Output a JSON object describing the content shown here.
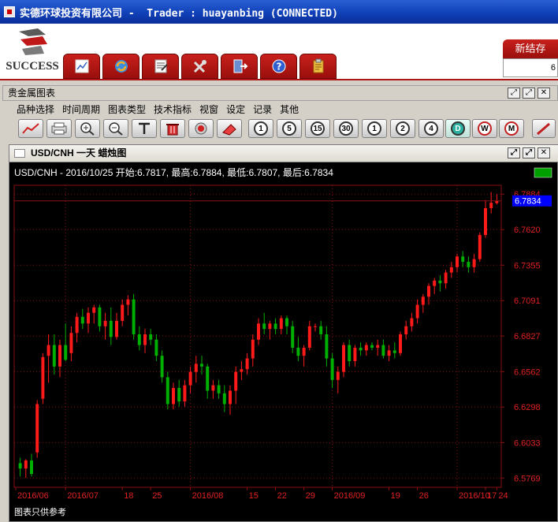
{
  "titlebar": {
    "title": "实德环球投资有限公司 -  Trader : huayanbing (CONNECTED)"
  },
  "logo": {
    "text": "SUCCESS"
  },
  "main_toolbar": [
    {
      "name": "chart-tool-button",
      "icon": "chart-paper-icon"
    },
    {
      "name": "refresh-tool-button",
      "icon": "refresh-icon"
    },
    {
      "name": "report-tool-button",
      "icon": "report-icon"
    },
    {
      "name": "settings-tool-button",
      "icon": "tools-icon"
    },
    {
      "name": "exit-tool-button",
      "icon": "exit-door-icon"
    },
    {
      "name": "help-tool-button",
      "icon": "help-icon"
    },
    {
      "name": "clipboard-tool-button",
      "icon": "clipboard-icon"
    }
  ],
  "newsave": {
    "label": "新结存",
    "value": "6"
  },
  "panel": {
    "title": "贵金属图表"
  },
  "menu": [
    "品种选择",
    "时间周期",
    "图表类型",
    "技术指标",
    "视窗",
    "设定",
    "记录",
    "其他"
  ],
  "chart_toolbar": {
    "periods": [
      "1",
      "5",
      "15",
      "30",
      "1",
      "2",
      "4",
      "D",
      "W",
      "M"
    ],
    "tools": [
      "line-chart-icon",
      "print-icon",
      "zoom-in-icon",
      "zoom-out-icon",
      "text-tool-icon",
      "delete-icon",
      "record-icon",
      "clear-icon"
    ]
  },
  "chart_window": {
    "caption": "USD/CNH 一天 蜡烛图",
    "info": "USD/CNH - 2016/10/25 开始:6.7817, 最高:6.7884, 最低:6.7807, 最后:6.7834",
    "disclaimer": "图表只供参考",
    "last_price_label": "6.7834",
    "colors": {
      "up": "#ff1a1a",
      "down": "#00b000",
      "grid": "#8a1010",
      "axis_text": "#e02020",
      "price_tag": "#0000ff"
    }
  },
  "chart_data": {
    "type": "candlestick",
    "title": "USD/CNH 一天 蜡烛图",
    "y_ticks": [
      6.5769,
      6.6033,
      6.6298,
      6.6562,
      6.6827,
      6.7091,
      6.7355,
      6.762,
      6.7884
    ],
    "ylim": [
      6.57,
      6.795
    ],
    "x_labels": [
      "2016/06",
      "2016/07",
      "18",
      "25",
      "2016/08",
      "15",
      "22",
      "29",
      "2016/09",
      "19",
      "26",
      "2016/10",
      "17",
      "24"
    ],
    "last_price": 6.7834,
    "candles": [
      {
        "o": 6.588,
        "h": 6.592,
        "l": 6.578,
        "c": 6.584
      },
      {
        "o": 6.584,
        "h": 6.591,
        "l": 6.577,
        "c": 6.59
      },
      {
        "o": 6.59,
        "h": 6.595,
        "l": 6.578,
        "c": 6.58
      },
      {
        "o": 6.596,
        "h": 6.635,
        "l": 6.592,
        "c": 6.632
      },
      {
        "o": 6.636,
        "h": 6.67,
        "l": 6.632,
        "c": 6.667
      },
      {
        "o": 6.668,
        "h": 6.684,
        "l": 6.648,
        "c": 6.676
      },
      {
        "o": 6.676,
        "h": 6.684,
        "l": 6.654,
        "c": 6.66
      },
      {
        "o": 6.66,
        "h": 6.68,
        "l": 6.652,
        "c": 6.676
      },
      {
        "o": 6.676,
        "h": 6.692,
        "l": 6.664,
        "c": 6.665
      },
      {
        "o": 6.67,
        "h": 6.69,
        "l": 6.664,
        "c": 6.685
      },
      {
        "o": 6.685,
        "h": 6.7,
        "l": 6.678,
        "c": 6.697
      },
      {
        "o": 6.697,
        "h": 6.703,
        "l": 6.688,
        "c": 6.692
      },
      {
        "o": 6.692,
        "h": 6.704,
        "l": 6.685,
        "c": 6.7
      },
      {
        "o": 6.7,
        "h": 6.706,
        "l": 6.692,
        "c": 6.704
      },
      {
        "o": 6.704,
        "h": 6.706,
        "l": 6.686,
        "c": 6.69
      },
      {
        "o": 6.69,
        "h": 6.7,
        "l": 6.68,
        "c": 6.694
      },
      {
        "o": 6.694,
        "h": 6.704,
        "l": 6.676,
        "c": 6.682
      },
      {
        "o": 6.682,
        "h": 6.7,
        "l": 6.68,
        "c": 6.694
      },
      {
        "o": 6.694,
        "h": 6.71,
        "l": 6.69,
        "c": 6.706
      },
      {
        "o": 6.706,
        "h": 6.713,
        "l": 6.698,
        "c": 6.71
      },
      {
        "o": 6.71,
        "h": 6.714,
        "l": 6.68,
        "c": 6.684
      },
      {
        "o": 6.684,
        "h": 6.69,
        "l": 6.672,
        "c": 6.676
      },
      {
        "o": 6.676,
        "h": 6.688,
        "l": 6.67,
        "c": 6.684
      },
      {
        "o": 6.684,
        "h": 6.688,
        "l": 6.676,
        "c": 6.68
      },
      {
        "o": 6.68,
        "h": 6.684,
        "l": 6.664,
        "c": 6.668
      },
      {
        "o": 6.668,
        "h": 6.672,
        "l": 6.648,
        "c": 6.652
      },
      {
        "o": 6.652,
        "h": 6.656,
        "l": 6.628,
        "c": 6.632
      },
      {
        "o": 6.632,
        "h": 6.648,
        "l": 6.628,
        "c": 6.644
      },
      {
        "o": 6.644,
        "h": 6.65,
        "l": 6.63,
        "c": 6.634
      },
      {
        "o": 6.634,
        "h": 6.65,
        "l": 6.63,
        "c": 6.646
      },
      {
        "o": 6.646,
        "h": 6.66,
        "l": 6.64,
        "c": 6.656
      },
      {
        "o": 6.656,
        "h": 6.668,
        "l": 6.648,
        "c": 6.662
      },
      {
        "o": 6.662,
        "h": 6.668,
        "l": 6.654,
        "c": 6.66
      },
      {
        "o": 6.66,
        "h": 6.662,
        "l": 6.636,
        "c": 6.642
      },
      {
        "o": 6.642,
        "h": 6.65,
        "l": 6.636,
        "c": 6.646
      },
      {
        "o": 6.646,
        "h": 6.65,
        "l": 6.636,
        "c": 6.64
      },
      {
        "o": 6.64,
        "h": 6.646,
        "l": 6.626,
        "c": 6.632
      },
      {
        "o": 6.632,
        "h": 6.646,
        "l": 6.624,
        "c": 6.642
      },
      {
        "o": 6.642,
        "h": 6.66,
        "l": 6.632,
        "c": 6.656
      },
      {
        "o": 6.656,
        "h": 6.664,
        "l": 6.65,
        "c": 6.658
      },
      {
        "o": 6.658,
        "h": 6.67,
        "l": 6.654,
        "c": 6.666
      },
      {
        "o": 6.666,
        "h": 6.684,
        "l": 6.66,
        "c": 6.68
      },
      {
        "o": 6.68,
        "h": 6.696,
        "l": 6.676,
        "c": 6.692
      },
      {
        "o": 6.692,
        "h": 6.7,
        "l": 6.684,
        "c": 6.688
      },
      {
        "o": 6.688,
        "h": 6.694,
        "l": 6.68,
        "c": 6.692
      },
      {
        "o": 6.692,
        "h": 6.696,
        "l": 6.684,
        "c": 6.688
      },
      {
        "o": 6.688,
        "h": 6.698,
        "l": 6.684,
        "c": 6.696
      },
      {
        "o": 6.696,
        "h": 6.698,
        "l": 6.684,
        "c": 6.69
      },
      {
        "o": 6.69,
        "h": 6.694,
        "l": 6.67,
        "c": 6.674
      },
      {
        "o": 6.674,
        "h": 6.682,
        "l": 6.664,
        "c": 6.668
      },
      {
        "o": 6.668,
        "h": 6.676,
        "l": 6.66,
        "c": 6.674
      },
      {
        "o": 6.674,
        "h": 6.694,
        "l": 6.672,
        "c": 6.69
      },
      {
        "o": 6.69,
        "h": 6.692,
        "l": 6.686,
        "c": 6.69
      },
      {
        "o": 6.69,
        "h": 6.694,
        "l": 6.68,
        "c": 6.684
      },
      {
        "o": 6.684,
        "h": 6.69,
        "l": 6.66,
        "c": 6.666
      },
      {
        "o": 6.666,
        "h": 6.67,
        "l": 6.644,
        "c": 6.65
      },
      {
        "o": 6.65,
        "h": 6.66,
        "l": 6.64,
        "c": 6.656
      },
      {
        "o": 6.656,
        "h": 6.678,
        "l": 6.652,
        "c": 6.676
      },
      {
        "o": 6.676,
        "h": 6.68,
        "l": 6.66,
        "c": 6.664
      },
      {
        "o": 6.664,
        "h": 6.676,
        "l": 6.66,
        "c": 6.674
      },
      {
        "o": 6.674,
        "h": 6.678,
        "l": 6.668,
        "c": 6.672
      },
      {
        "o": 6.672,
        "h": 6.678,
        "l": 6.668,
        "c": 6.676
      },
      {
        "o": 6.676,
        "h": 6.678,
        "l": 6.672,
        "c": 6.674
      },
      {
        "o": 6.674,
        "h": 6.68,
        "l": 6.668,
        "c": 6.676
      },
      {
        "o": 6.676,
        "h": 6.68,
        "l": 6.666,
        "c": 6.668
      },
      {
        "o": 6.668,
        "h": 6.676,
        "l": 6.664,
        "c": 6.672
      },
      {
        "o": 6.672,
        "h": 6.678,
        "l": 6.666,
        "c": 6.67
      },
      {
        "o": 6.67,
        "h": 6.686,
        "l": 6.668,
        "c": 6.684
      },
      {
        "o": 6.684,
        "h": 6.694,
        "l": 6.68,
        "c": 6.69
      },
      {
        "o": 6.69,
        "h": 6.7,
        "l": 6.686,
        "c": 6.696
      },
      {
        "o": 6.696,
        "h": 6.71,
        "l": 6.692,
        "c": 6.706
      },
      {
        "o": 6.706,
        "h": 6.714,
        "l": 6.7,
        "c": 6.712
      },
      {
        "o": 6.712,
        "h": 6.722,
        "l": 6.706,
        "c": 6.72
      },
      {
        "o": 6.72,
        "h": 6.726,
        "l": 6.714,
        "c": 6.724
      },
      {
        "o": 6.724,
        "h": 6.728,
        "l": 6.716,
        "c": 6.722
      },
      {
        "o": 6.722,
        "h": 6.732,
        "l": 6.718,
        "c": 6.73
      },
      {
        "o": 6.73,
        "h": 6.738,
        "l": 6.726,
        "c": 6.734
      },
      {
        "o": 6.734,
        "h": 6.744,
        "l": 6.73,
        "c": 6.742
      },
      {
        "o": 6.742,
        "h": 6.746,
        "l": 6.734,
        "c": 6.738
      },
      {
        "o": 6.738,
        "h": 6.742,
        "l": 6.73,
        "c": 6.734
      },
      {
        "o": 6.734,
        "h": 6.744,
        "l": 6.73,
        "c": 6.74
      },
      {
        "o": 6.74,
        "h": 6.76,
        "l": 6.738,
        "c": 6.758
      },
      {
        "o": 6.758,
        "h": 6.784,
        "l": 6.756,
        "c": 6.778
      },
      {
        "o": 6.778,
        "h": 6.79,
        "l": 6.774,
        "c": 6.782
      },
      {
        "o": 6.7817,
        "h": 6.7884,
        "l": 6.7807,
        "c": 6.7834
      }
    ]
  }
}
